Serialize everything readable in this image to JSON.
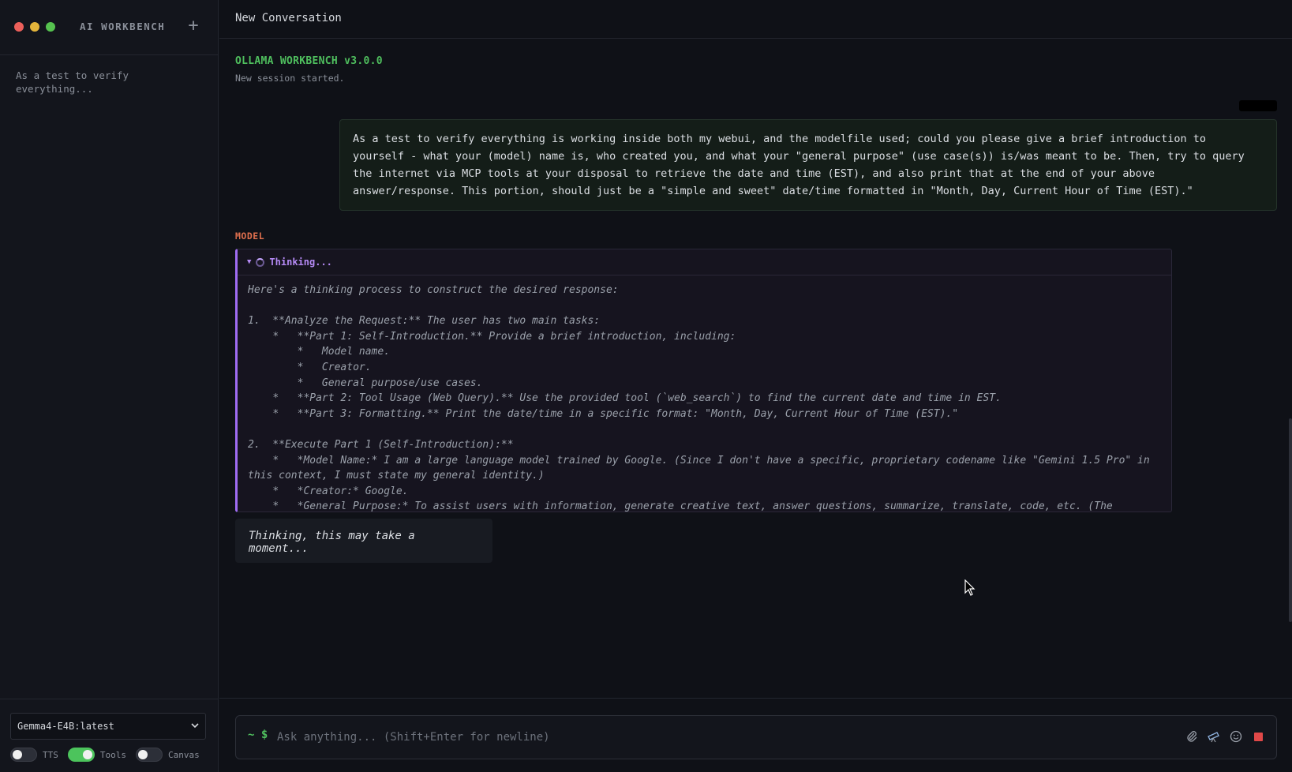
{
  "sidebar": {
    "title": "AI WORKBENCH",
    "new_chat_icon": "plus-icon",
    "conversations": [
      "As a test to verify everything..."
    ],
    "model_selected": "Gemma4-E4B:latest",
    "toggles": [
      {
        "label": "TTS",
        "on": false
      },
      {
        "label": "Tools",
        "on": true
      },
      {
        "label": "Canvas",
        "on": false
      }
    ]
  },
  "header": {
    "title": "New Conversation"
  },
  "system": {
    "title": "OLLAMA WORKBENCH v3.0.0",
    "subtitle": "New session started."
  },
  "messages": {
    "user_text": "As a test to verify everything is working inside both my webui, and the modelfile used; could you please give a brief introduction to yourself - what your (model) name is, who created you, and what your \"general purpose\" (use case(s)) is/was meant to be. Then, try to query the internet via MCP tools at your disposal to retrieve the date and time (EST), and also print that at the end of your above answer/response. This portion, should just be a \"simple and sweet\" date/time formatted in \"Month, Day, Current Hour of Time (EST).\"",
    "model_label": "MODEL",
    "thinking_label": "Thinking...",
    "thinking_text": "Here's a thinking process to construct the desired response:\n\n1.  **Analyze the Request:** The user has two main tasks:\n    *   **Part 1: Self-Introduction.** Provide a brief introduction, including:\n        *   Model name.\n        *   Creator.\n        *   General purpose/use cases.\n    *   **Part 2: Tool Usage (Web Query).** Use the provided tool (`web_search`) to find the current date and time in EST.\n    *   **Part 3: Formatting.** Print the date/time in a specific format: \"Month, Day, Current Hour of Time (EST).\"\n\n2.  **Execute Part 1 (Self-Introduction):**\n    *   *Model Name:* I am a large language model trained by Google. (Since I don't have a specific, proprietary codename like \"Gemini 1.5 Pro\" in this context, I must state my general identity.)\n    *   *Creator:* Google.\n    *   *General Purpose:* To assist users with information, generate creative text, answer questions, summarize, translate, code, etc. (The",
    "waiting_text": "Thinking, this may take a moment..."
  },
  "input": {
    "prompt": "~ $",
    "placeholder": "Ask anything... (Shift+Enter for newline)",
    "icons": [
      "paperclip-icon",
      "telescope-icon",
      "emoji-icon",
      "stop-icon"
    ]
  }
}
